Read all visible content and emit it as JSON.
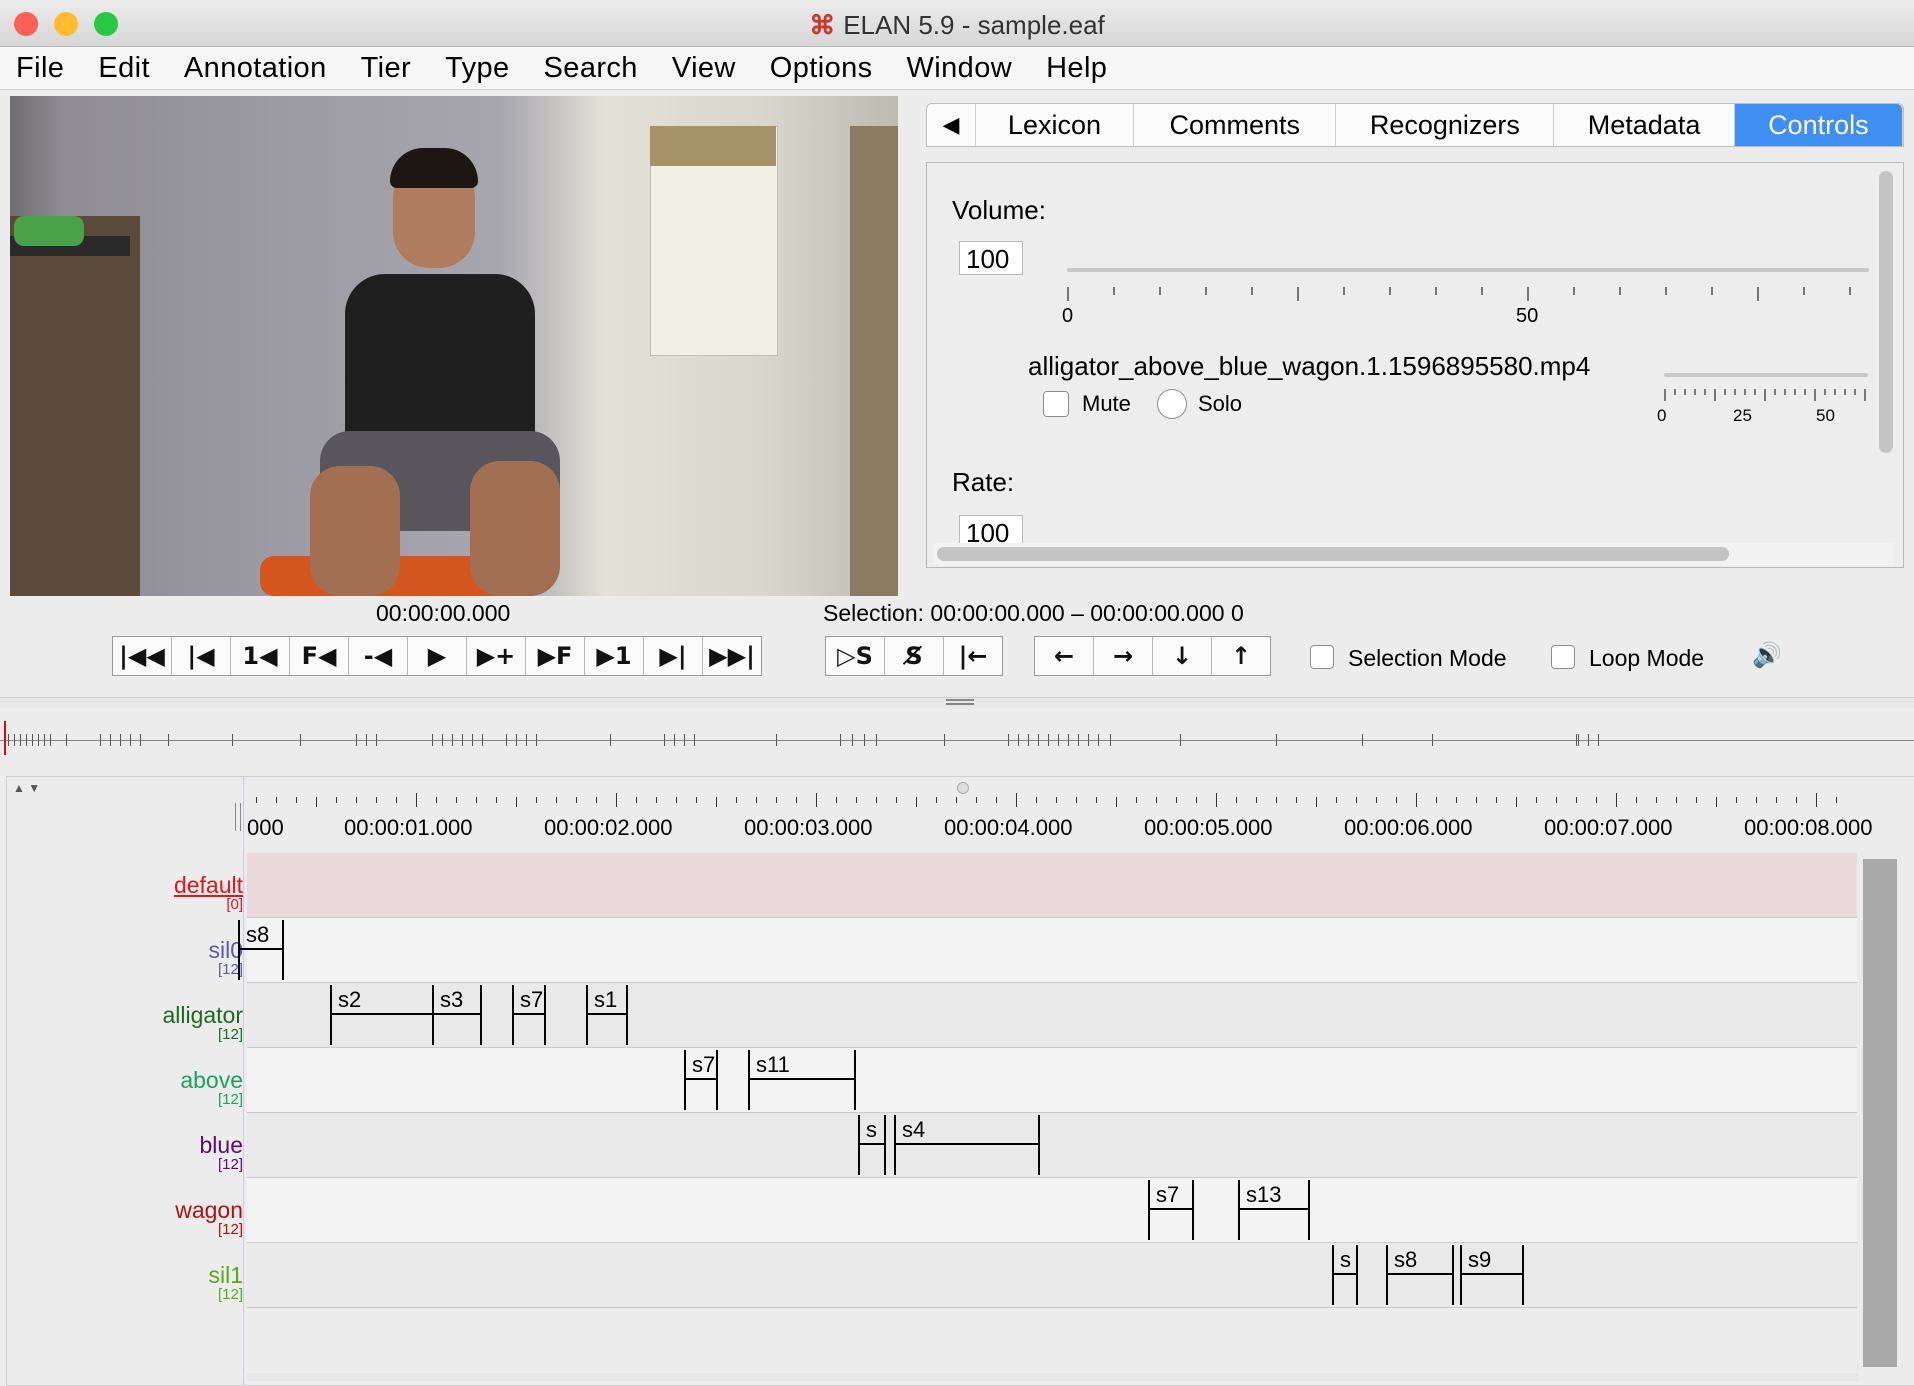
{
  "window": {
    "title": "ELAN 5.9 - sample.eaf",
    "logo_glyph": "⌘",
    "traffic_colors": [
      "#fe5f57",
      "#febc2e",
      "#28c840"
    ]
  },
  "menu": [
    "File",
    "Edit",
    "Annotation",
    "Tier",
    "Type",
    "Search",
    "View",
    "Options",
    "Window",
    "Help"
  ],
  "player": {
    "timecode": "00:00:00.000",
    "selection_text": "Selection: 00:00:00.000 – 00:00:00.000  0",
    "transport_buttons": [
      {
        "glyph": "|◀◀",
        "icon": "go-to-start-icon"
      },
      {
        "glyph": "|◀",
        "icon": "previous-scrollview-icon"
      },
      {
        "glyph": "1◀",
        "icon": "previous-second-icon"
      },
      {
        "glyph": "F◀",
        "icon": "previous-frame-icon"
      },
      {
        "glyph": "-◀",
        "icon": "previous-pixel-icon"
      },
      {
        "glyph": "▶",
        "icon": "play-icon"
      },
      {
        "glyph": "▶+",
        "icon": "next-pixel-icon"
      },
      {
        "glyph": "▶F",
        "icon": "next-frame-icon"
      },
      {
        "glyph": "▶1",
        "icon": "next-second-icon"
      },
      {
        "glyph": "▶|",
        "icon": "next-scrollview-icon"
      },
      {
        "glyph": "▶▶|",
        "icon": "go-to-end-icon"
      }
    ],
    "selection_buttons": [
      {
        "glyph": "▷S",
        "icon": "play-selection-icon"
      },
      {
        "glyph": "S̸",
        "icon": "clear-selection-icon"
      },
      {
        "glyph": "|←",
        "icon": "move-to-selection-boundary-icon"
      }
    ],
    "nav_buttons": [
      {
        "glyph": "←",
        "icon": "arrow-left-icon"
      },
      {
        "glyph": "→",
        "icon": "arrow-right-icon"
      },
      {
        "glyph": "↓",
        "icon": "arrow-down-icon"
      },
      {
        "glyph": "↑",
        "icon": "arrow-up-icon"
      }
    ],
    "selection_mode_label": "Selection Mode",
    "loop_mode_label": "Loop Mode",
    "speaker_glyph": "🔊"
  },
  "tabs": {
    "back_glyph": "◀",
    "items": [
      "Lexicon",
      "Comments",
      "Recognizers",
      "Metadata",
      "Controls"
    ],
    "active": "Controls",
    "active_color": "#3f8ff3"
  },
  "controls": {
    "volume_label": "Volume:",
    "volume_value": "100",
    "volume_ticks": [
      "0",
      "50"
    ],
    "media_file": "alligator_above_blue_wagon.1.1596895580.mp4",
    "mute_label": "Mute",
    "solo_label": "Solo",
    "media_ticks": [
      "0",
      "25",
      "50"
    ],
    "rate_label": "Rate:",
    "rate_value": "100"
  },
  "timeline": {
    "ruler_labels": [
      "000",
      "00:00:01.000",
      "00:00:02.000",
      "00:00:03.000",
      "00:00:04.000",
      "00:00:05.000",
      "00:00:06.000",
      "00:00:07.000",
      "00:00:08.000"
    ],
    "tiers": [
      {
        "name": "default",
        "count": "[0]",
        "color": "#e0161c",
        "segments": []
      },
      {
        "name": "sil0",
        "count": "[12]",
        "color": "#5a5aa8",
        "segments": [
          {
            "label": "s8",
            "start": 0.11,
            "end": 0.33
          }
        ]
      },
      {
        "name": "alligator",
        "count": "[12]",
        "color": "#1c6b1c",
        "segments": [
          {
            "label": "s2",
            "start": 0.57,
            "end": 1.08
          },
          {
            "label": "s3",
            "start": 1.08,
            "end": 1.32
          },
          {
            "label": "s7",
            "start": 1.48,
            "end": 1.64
          },
          {
            "label": "s1",
            "start": 1.85,
            "end": 2.05
          }
        ]
      },
      {
        "name": "above",
        "count": "[12]",
        "color": "#1aa35a",
        "segments": [
          {
            "label": "s7",
            "start": 2.34,
            "end": 2.5
          },
          {
            "label": "s11",
            "start": 2.66,
            "end": 3.19
          }
        ]
      },
      {
        "name": "blue",
        "count": "[12]",
        "color": "#5a0e6b",
        "segments": [
          {
            "label": "s",
            "start": 3.21,
            "end": 3.34
          },
          {
            "label": "s4",
            "start": 3.39,
            "end": 4.11
          }
        ]
      },
      {
        "name": "wagon",
        "count": "[12]",
        "color": "#b01010",
        "segments": [
          {
            "label": "s7",
            "start": 4.66,
            "end": 4.88
          },
          {
            "label": "s13",
            "start": 5.11,
            "end": 5.46
          }
        ]
      },
      {
        "name": "sil1",
        "count": "[12]",
        "color": "#5aa81a",
        "segments": [
          {
            "label": "s",
            "start": 5.58,
            "end": 5.7
          },
          {
            "label": "s8",
            "start": 5.85,
            "end": 6.18
          },
          {
            "label": "s9",
            "start": 6.22,
            "end": 6.53
          }
        ]
      }
    ]
  }
}
